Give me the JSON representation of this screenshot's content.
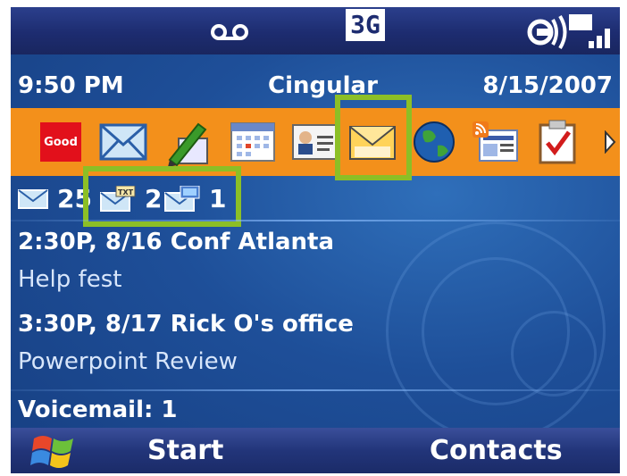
{
  "status": {
    "network_label": "3G"
  },
  "info": {
    "time": "9:50 PM",
    "carrier": "Cingular",
    "date": "8/15/2007"
  },
  "app_strip": {
    "icons": [
      "good-icon",
      "email-icon",
      "notes-icon",
      "calendar-icon",
      "contacts-card-icon",
      "messaging-icon",
      "globe-icon",
      "rss-icon",
      "tasks-icon",
      "scroll-right-icon"
    ],
    "good_label": "Good",
    "selected": "messaging-icon"
  },
  "counts": {
    "email_count": "25",
    "sms_count": "2",
    "mms_count": "1",
    "sms_badge": "TXT"
  },
  "appointments": [
    {
      "title": "2:30P, 8/16 Conf Atlanta",
      "subject": "Help fest"
    },
    {
      "title": "3:30P, 8/17 Rick O's office",
      "subject": "Powerpoint Review"
    }
  ],
  "voicemail": "Voicemail: 1",
  "softkeys": {
    "left": "Start",
    "right": "Contacts"
  },
  "colors": {
    "accent_highlight": "#8cbf26",
    "icon_strip": "#f3901b",
    "background": "#1e4f99"
  }
}
